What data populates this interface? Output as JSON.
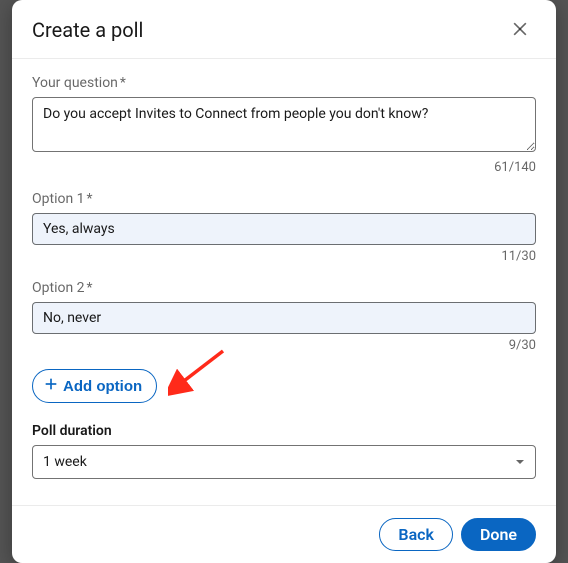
{
  "header": {
    "title": "Create a poll"
  },
  "question": {
    "label": "Your question",
    "value": "Do you accept Invites to Connect from people you don't know?",
    "counter": "61/140"
  },
  "options": [
    {
      "label": "Option 1",
      "value": "Yes, always",
      "counter": "11/30"
    },
    {
      "label": "Option 2",
      "value": "No, never",
      "counter": "9/30"
    }
  ],
  "add_option_label": "Add option",
  "duration": {
    "label": "Poll duration",
    "value": "1 week"
  },
  "footer": {
    "back": "Back",
    "done": "Done"
  },
  "colors": {
    "accent": "#0a66c2",
    "arrow": "#ff2a1a"
  }
}
